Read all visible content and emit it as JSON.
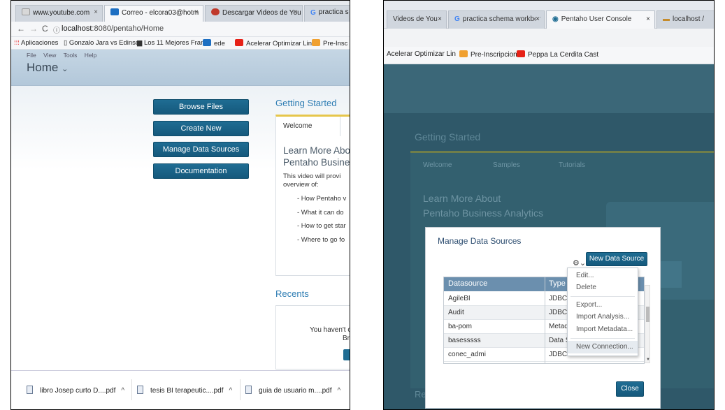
{
  "left": {
    "tabs": [
      {
        "label": "www.youtube.com",
        "icon": "youtube-icon"
      },
      {
        "label": "Correo - elcora03@hotm",
        "icon": "outlook-icon"
      },
      {
        "label": "Descargar Videos de You",
        "icon": "download-icon"
      },
      {
        "label": "practica s",
        "icon": "google-icon"
      }
    ],
    "url_host": "localhost",
    "url_path": ":8080/pentaho/Home",
    "bookmarks": [
      "Aplicaciones",
      "Gonzalo Jara vs Edinsc",
      "Los 11 Mejores Frame",
      "ede",
      "Acelerar Optimizar Lin",
      "Pre-Insc"
    ],
    "menu": [
      "File",
      "View",
      "Tools",
      "Help"
    ],
    "perspective": "Home",
    "buttons": [
      "Browse Files",
      "Create New",
      "Manage Data Sources",
      "Documentation"
    ],
    "getting_started": {
      "title": "Getting Started",
      "tab": "Welcome",
      "heading_line1": "Learn More Abo",
      "heading_line2": "Pentaho Busine",
      "intro_line1": "This video will provi",
      "intro_line2": "overview of:",
      "bullets": [
        "- How Pentaho v",
        "- What it can do",
        "- How to get star",
        "- Where to go fo"
      ]
    },
    "recents": {
      "title": "Recents",
      "empty_line1": "You haven't op",
      "empty_line2": "Brov"
    },
    "downloads": [
      {
        "name": "libro Josep curto D....pdf"
      },
      {
        "name": "tesis BI terapeutic....pdf"
      },
      {
        "name": "guia de usuario m....pdf"
      }
    ]
  },
  "right": {
    "tabs": [
      {
        "label": "Videos de You"
      },
      {
        "label": "practica schema workber",
        "icon": "google-icon"
      },
      {
        "label": "Pentaho User Console",
        "icon": "pentaho-icon"
      },
      {
        "label": "localhost /",
        "icon": "folder-icon"
      }
    ],
    "bookmarks": [
      "Acelerar Optimizar Lin",
      "Pre-Inscripcion",
      "Peppa La Cerdita Cast"
    ],
    "background": {
      "gs_title": "Getting Started",
      "tabs": [
        "Welcome",
        "Samples",
        "Tutorials"
      ],
      "heading_line1": "Learn More About",
      "heading_line2": "Pentaho Business Analytics",
      "recents_prefix": "Rec"
    },
    "dialog": {
      "title": "Manage Data Sources",
      "new_button": "New Data Source",
      "columns": [
        "Datasource",
        "Type"
      ],
      "rows": [
        {
          "name": "AgileBI",
          "type": "JDBC"
        },
        {
          "name": "Audit",
          "type": "JDBC"
        },
        {
          "name": "ba-pom",
          "type": "Metada"
        },
        {
          "name": "basesssss",
          "type": "Data Sc"
        },
        {
          "name": "conec_admi",
          "type": "JDBC"
        }
      ],
      "menu": [
        "Edit...",
        "Delete",
        "Export...",
        "Import Analysis...",
        "Import Metadata...",
        "New Connection..."
      ],
      "close_button": "Close"
    }
  },
  "colors": {
    "pentaho_blue": "#1f6d93",
    "link_blue": "#2e7db3",
    "dim_overlay": "#2f5869",
    "table_header": "#6b8fae"
  }
}
